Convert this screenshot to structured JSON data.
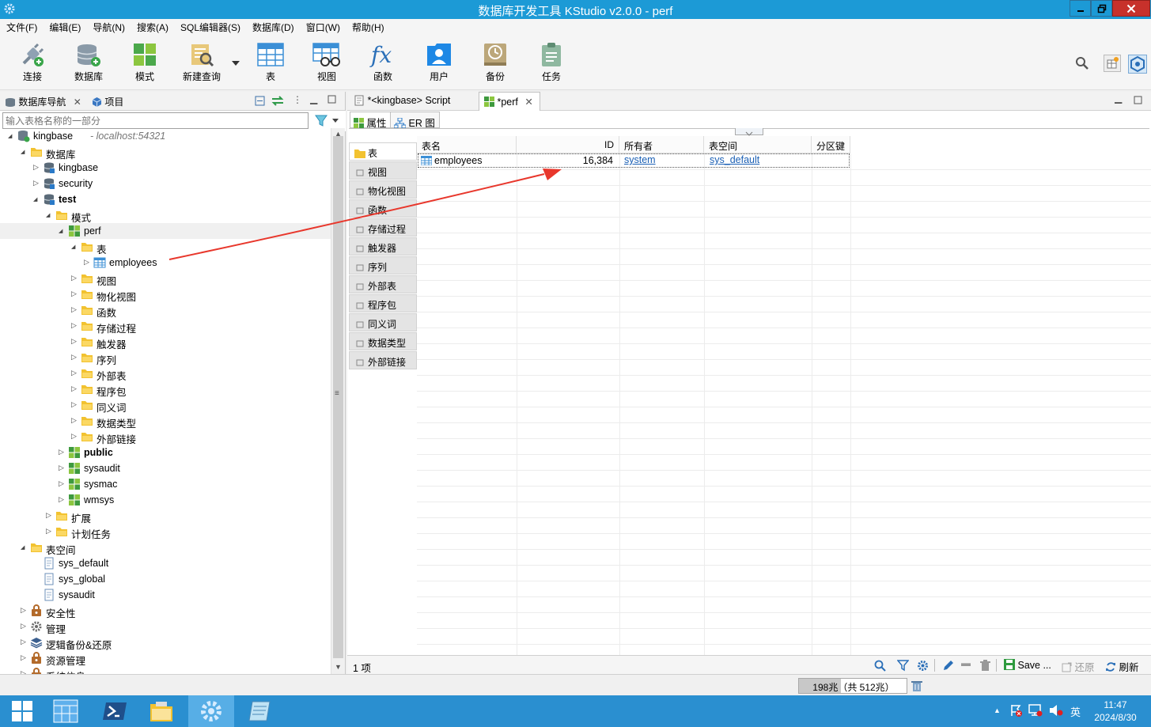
{
  "window": {
    "title": "数据库开发工具 KStudio v2.0.0 - perf"
  },
  "menu": [
    "文件(F)",
    "编辑(E)",
    "导航(N)",
    "搜索(A)",
    "SQL编辑器(S)",
    "数据库(D)",
    "窗口(W)",
    "帮助(H)"
  ],
  "toolbar": {
    "items": [
      {
        "label": "连接",
        "icon": "connect-plug-icon"
      },
      {
        "label": "数据库",
        "icon": "database-add-icon"
      },
      {
        "label": "模式",
        "icon": "schema-grid-icon"
      },
      {
        "label": "新建查询",
        "icon": "new-query-icon"
      },
      {
        "label": "表",
        "icon": "table-icon"
      },
      {
        "label": "视图",
        "icon": "view-glasses-icon"
      },
      {
        "label": "函数",
        "icon": "function-fx-icon"
      },
      {
        "label": "用户",
        "icon": "user-icon"
      },
      {
        "label": "备份",
        "icon": "backup-clock-icon"
      },
      {
        "label": "任务",
        "icon": "task-clipboard-icon"
      }
    ]
  },
  "left_panel": {
    "tabs": [
      {
        "label": "数据库导航"
      },
      {
        "label": "项目"
      }
    ],
    "filter_placeholder": "输入表格名称的一部分",
    "tree": [
      {
        "label": "kingbase",
        "sub": "- localhost:54321",
        "level": 0,
        "arrow": "open",
        "icon": "server"
      },
      {
        "label": "数据库",
        "level": 1,
        "arrow": "open",
        "icon": "folder"
      },
      {
        "label": "kingbase",
        "level": 2,
        "arrow": "closed",
        "icon": "db"
      },
      {
        "label": "security",
        "level": 2,
        "arrow": "closed",
        "icon": "db"
      },
      {
        "label": "test",
        "level": 2,
        "arrow": "open",
        "icon": "db",
        "bold": true
      },
      {
        "label": "模式",
        "level": 3,
        "arrow": "open",
        "icon": "folder"
      },
      {
        "label": "perf",
        "level": 4,
        "arrow": "open",
        "icon": "schema",
        "selected": true
      },
      {
        "label": "表",
        "level": 5,
        "arrow": "open",
        "icon": "folder"
      },
      {
        "label": "employees",
        "level": 6,
        "arrow": "closed",
        "icon": "table"
      },
      {
        "label": "视图",
        "level": 5,
        "arrow": "closed",
        "icon": "folder"
      },
      {
        "label": "物化视图",
        "level": 5,
        "arrow": "closed",
        "icon": "folder"
      },
      {
        "label": "函数",
        "level": 5,
        "arrow": "closed",
        "icon": "folder"
      },
      {
        "label": "存储过程",
        "level": 5,
        "arrow": "closed",
        "icon": "folder"
      },
      {
        "label": "触发器",
        "level": 5,
        "arrow": "closed",
        "icon": "folder"
      },
      {
        "label": "序列",
        "level": 5,
        "arrow": "closed",
        "icon": "folder"
      },
      {
        "label": "外部表",
        "level": 5,
        "arrow": "closed",
        "icon": "folder"
      },
      {
        "label": "程序包",
        "level": 5,
        "arrow": "closed",
        "icon": "folder"
      },
      {
        "label": "同义词",
        "level": 5,
        "arrow": "closed",
        "icon": "folder"
      },
      {
        "label": "数据类型",
        "level": 5,
        "arrow": "closed",
        "icon": "folder"
      },
      {
        "label": "外部链接",
        "level": 5,
        "arrow": "closed",
        "icon": "folder"
      },
      {
        "label": "public",
        "level": 4,
        "arrow": "closed",
        "icon": "schema",
        "bold": true
      },
      {
        "label": "sysaudit",
        "level": 4,
        "arrow": "closed",
        "icon": "schema"
      },
      {
        "label": "sysmac",
        "level": 4,
        "arrow": "closed",
        "icon": "schema"
      },
      {
        "label": "wmsys",
        "level": 4,
        "arrow": "closed",
        "icon": "schema"
      },
      {
        "label": "扩展",
        "level": 3,
        "arrow": "closed",
        "icon": "folder"
      },
      {
        "label": "计划任务",
        "level": 3,
        "arrow": "closed",
        "icon": "folder"
      },
      {
        "label": "表空间",
        "level": 1,
        "arrow": "open",
        "icon": "folder"
      },
      {
        "label": "sys_default",
        "level": 2,
        "arrow": "none",
        "icon": "file"
      },
      {
        "label": "sys_global",
        "level": 2,
        "arrow": "none",
        "icon": "file"
      },
      {
        "label": "sysaudit",
        "level": 2,
        "arrow": "none",
        "icon": "file"
      },
      {
        "label": "安全性",
        "level": 1,
        "arrow": "closed",
        "icon": "lock"
      },
      {
        "label": "管理",
        "level": 1,
        "arrow": "closed",
        "icon": "gear"
      },
      {
        "label": "逻辑备份&还原",
        "level": 1,
        "arrow": "closed",
        "icon": "layers"
      },
      {
        "label": "资源管理",
        "level": 1,
        "arrow": "closed",
        "icon": "lock"
      },
      {
        "label": "系统信息",
        "level": 1,
        "arrow": "closed",
        "icon": "lock"
      }
    ]
  },
  "editor": {
    "tabs": [
      {
        "label": "*<kingbase> Script"
      },
      {
        "label": "*perf"
      }
    ],
    "subtabs": [
      {
        "label": "属性"
      },
      {
        "label": "ER 图"
      }
    ],
    "object_types": [
      "表",
      "视图",
      "物化视图",
      "函数",
      "存储过程",
      "触发器",
      "序列",
      "外部表",
      "程序包",
      "同义词",
      "数据类型",
      "外部链接"
    ],
    "grid": {
      "columns": [
        "表名",
        "ID",
        "所有者",
        "表空间",
        "分区键"
      ],
      "rows": [
        {
          "name": "employees",
          "id": "16,384",
          "owner": "system",
          "tablespace": "sys_default",
          "partition_key": ""
        }
      ]
    },
    "status": {
      "count": "1 项",
      "save": "Save ...",
      "restore": "还原",
      "refresh": "刷新"
    }
  },
  "heap": {
    "text": "198兆（共 512兆）",
    "fraction": 0.387
  },
  "taskbar": {
    "lang": "英",
    "time": "11:47",
    "date": "2024/8/30"
  },
  "colors": {
    "titlebar": "#1c9ad6",
    "taskbar": "#2a8fd0",
    "accent_red_arrow": "#e8372c",
    "link": "#1a5fb4",
    "folder": "#f2c230",
    "schema_green": "#3e9a3e"
  }
}
